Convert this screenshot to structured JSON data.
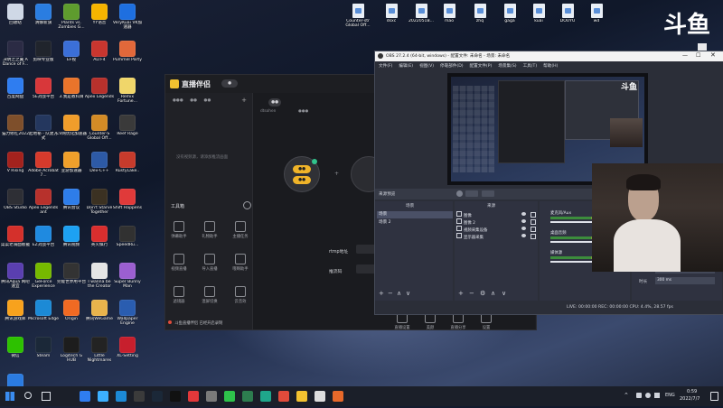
{
  "desktop_icons": [
    {
      "label": "回收站",
      "color": "#cfd8e6"
    },
    {
      "label": "清娜新旗",
      "color": "#2a7de1"
    },
    {
      "label": "Plants vs. Zombies G...",
      "color": "#5e9c2e"
    },
    {
      "label": "YY语音",
      "color": "#f5b400"
    },
    {
      "label": "VeryKuai VK加速器",
      "color": "#1e6fe0"
    },
    {
      "label": "决明之之翼 A Dance of F...",
      "color": "#2b2b44"
    },
    {
      "label": "剪映专业版",
      "color": "#20242c"
    },
    {
      "label": "EF视",
      "color": "#3b6fd8"
    },
    {
      "label": "ALTF4",
      "color": "#c9362f"
    },
    {
      "label": "Pummel Party",
      "color": "#e2683a"
    },
    {
      "label": "百度网盘",
      "color": "#2f7df0"
    },
    {
      "label": "5E对战平台",
      "color": "#d8373a"
    },
    {
      "label": "3.我是教科目",
      "color": "#e9742b"
    },
    {
      "label": "Apex Legends",
      "color": "#b7312c"
    },
    {
      "label": "Remix Fortune...",
      "color": "#f0d66a"
    },
    {
      "label": "猫力修红2022",
      "color": "#7e4f2b"
    },
    {
      "label": "起地秘 - 队建方式",
      "color": "#24375e"
    },
    {
      "label": "CV网优化加速器",
      "color": "#f09d2b"
    },
    {
      "label": "Counter-S Global Off...",
      "color": "#d38b26"
    },
    {
      "label": "Reef Rage",
      "color": "#3a3a3a"
    },
    {
      "label": "V Rising",
      "color": "#a3221d"
    },
    {
      "label": "Adobe Acrobat 7...",
      "color": "#d63a2c"
    },
    {
      "label": "亚游加速器",
      "color": "#f0a02b"
    },
    {
      "label": "Dev-C++",
      "color": "#2d5aa6"
    },
    {
      "label": "RustyLake..",
      "color": "#c73b2c"
    },
    {
      "label": "OBS Studio",
      "color": "#2e2f35"
    },
    {
      "label": "Apex Legends ant",
      "color": "#b7312c"
    },
    {
      "label": "腾讯会议",
      "color": "#2e7de9"
    },
    {
      "label": "Don't Starve Together",
      "color": "#3b3122"
    },
    {
      "label": "Shift Happens",
      "color": "#e03a3a"
    },
    {
      "label": "菜菜老骑面板截",
      "color": "#d4302b"
    },
    {
      "label": "EZ对战平台",
      "color": "#1f8ae0"
    },
    {
      "label": "腾讯视频",
      "color": "#1da1f2"
    },
    {
      "label": "英火棋行",
      "color": "#d92e2e"
    },
    {
      "label": "SpeedRu...",
      "color": "#313131"
    },
    {
      "label": "腾讯Aqua 网吧速宜",
      "color": "#5a3fb0"
    },
    {
      "label": "GeForce Experience",
      "color": "#76b900"
    },
    {
      "label": "完能世界用平台",
      "color": "#333333"
    },
    {
      "label": "I wanna be the Creator",
      "color": "#e5e5e5"
    },
    {
      "label": "Super Bunny Man",
      "color": "#9b5fd0"
    },
    {
      "label": "腾讯游戏库",
      "color": "#f7a21d"
    },
    {
      "label": "Microsoft Edge",
      "color": "#1c8ad6"
    },
    {
      "label": "Origin",
      "color": "#f06a23"
    },
    {
      "label": "腾讯WeGame",
      "color": "#e9b44c"
    },
    {
      "label": "Wallpaper Engine",
      "color": "#2a5db0"
    },
    {
      "label": "微信",
      "color": "#2dc100"
    },
    {
      "label": "Steam",
      "color": "#1b2838"
    },
    {
      "label": "Logitech G HUB",
      "color": "#1d1d1d"
    },
    {
      "label": "Little Nightmares",
      "color": "#232323"
    },
    {
      "label": "XL-Setting",
      "color": "#c71f2d"
    },
    {
      "label": "迅雷",
      "color": "#2b7be0"
    }
  ],
  "top_files": [
    {
      "label": "Counter-str Global Off..."
    },
    {
      "label": "dsxc"
    },
    {
      "label": "2022051B..."
    },
    {
      "label": "mao"
    },
    {
      "label": "zhq"
    },
    {
      "label": "gaga"
    },
    {
      "label": "kuai"
    },
    {
      "label": "DOUYU"
    },
    {
      "label": "wd"
    }
  ],
  "live_app": {
    "brand": "直播伴侣",
    "search_placeholder": "搜索",
    "center_text": "没有视频源，请添加推流画面",
    "tool_section": "工具箱",
    "tools": [
      {
        "label": "弹幕助手"
      },
      {
        "label": "礼物助手"
      },
      {
        "label": "主播任务"
      },
      {
        "label": "视频直播"
      },
      {
        "label": "导入直播"
      },
      {
        "label": "哦啊助手"
      },
      {
        "label": "滤镜器"
      },
      {
        "label": "混屏切换"
      },
      {
        "label": "云音效"
      }
    ],
    "rtmp_label": "rtmp地址",
    "stream_label": "推流码",
    "bottom_actions": [
      {
        "label": "直播设置"
      },
      {
        "label": "美颜"
      },
      {
        "label": "直播分享"
      },
      {
        "label": "设置"
      }
    ],
    "notice": "斗鱼直播伴侣 已经开启录制",
    "user_tag": "dtsohen"
  },
  "obs": {
    "title": "OBS 27.2.4 (64-bit, windows) - 配置文件: 未命名 - 场景: 未命名",
    "menu": [
      "文件(F)",
      "编辑(E)",
      "视图(V)",
      "停靠部件(D)",
      "配置文件(P)",
      "场景集(S)",
      "工具(T)",
      "帮助(H)"
    ],
    "panel_header": "来源预览",
    "scenes_title": "场景",
    "scenes": [
      "场景",
      "场景 2"
    ],
    "sources_title": "来源",
    "sources": [
      "图像",
      "图像 2",
      "视频采集设备",
      "显示器采集"
    ],
    "mixer": [
      {
        "label": "麦克风/Aux"
      },
      {
        "label": "桌面音频"
      },
      {
        "label": "媒体源"
      }
    ],
    "mixer_level": 0.75,
    "transition_label": "渐变过渡(淡)",
    "duration_label": "时长",
    "duration_value": "300 ms",
    "status": "LIVE: 00:00:00  REC: 00:00:00  CPU: 4.4%, 28.57 fps"
  },
  "taskbar": {
    "time": "0:59",
    "date": "2022/7/7",
    "lang": "ENG"
  },
  "brand_logo_text": "斗鱼"
}
